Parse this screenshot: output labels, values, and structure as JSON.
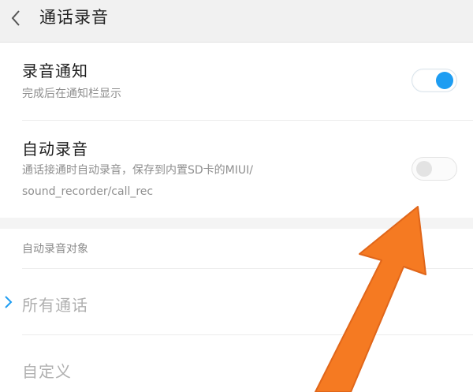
{
  "header": {
    "title": "通话录音"
  },
  "settings": {
    "record_notification": {
      "title": "录音通知",
      "subtitle": "完成后在通知栏显示",
      "enabled": true
    },
    "auto_record": {
      "title": "自动录音",
      "subtitle_line1": "通话接通时自动录音，保存到内置SD卡的MIUI/",
      "subtitle_line2": "sound_recorder/call_rec",
      "enabled": false
    }
  },
  "auto_record_target": {
    "section_title": "自动录音对象",
    "options": [
      {
        "label": "所有通话",
        "selected": true
      },
      {
        "label": "自定义",
        "selected": false
      }
    ]
  },
  "colors": {
    "accent": "#1e9df2",
    "arrow": "#f57a22"
  }
}
